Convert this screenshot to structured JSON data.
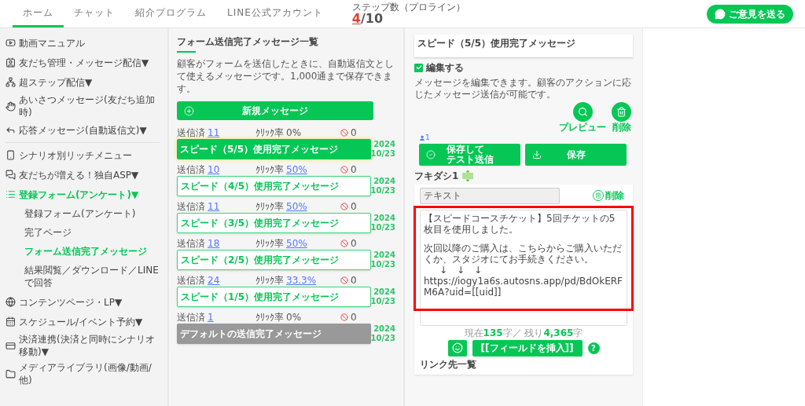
{
  "nav": {
    "tabs": [
      {
        "label": "ホーム",
        "selected": true
      },
      {
        "label": "チャット",
        "selected": false
      },
      {
        "label": "紹介プログラム",
        "selected": false
      },
      {
        "label": "LINE公式アカウント",
        "selected": false
      }
    ],
    "step_label": "ステップ数（プロライン）",
    "step_used": "4",
    "step_total": "/10",
    "feedback_button": "ご意見を送る"
  },
  "sidebar": {
    "groups": [
      [
        {
          "label": "動画マニュアル",
          "selected": false
        },
        {
          "label": "友だち管理・メッセージ配信",
          "arrow": "▼",
          "selected": false
        },
        {
          "label": "超ステップ配信",
          "arrow": "▼",
          "selected": false
        },
        {
          "label": "あいさつメッセージ",
          "note": "(友だち追加時)",
          "selected": false
        },
        {
          "label": "応答メッセージ",
          "note": "(自動返信文)",
          "arrow": "▼",
          "selected": false
        }
      ],
      [
        {
          "label": "シナリオ別リッチメニュー",
          "selected": false
        },
        {
          "label": "友だちが増える！独自ASP",
          "arrow": "▼",
          "selected": false
        },
        {
          "label": "登録フォーム",
          "note": "(アンケート)",
          "arrow": "▼",
          "selected": true,
          "children": [
            {
              "label": "登録フォーム",
              "note": "(アンケート)",
              "selected": false
            },
            {
              "label": "完了ページ",
              "selected": false
            },
            {
              "label": "フォーム送信完了メッセージ",
              "selected": true
            },
            {
              "label": "結果閲覧／ダウンロード／LINEで回答",
              "selected": false
            }
          ]
        },
        {
          "label": "コンテンツページ・LP",
          "arrow": "▼",
          "selected": false
        },
        {
          "label": "スケジュール/イベント予約",
          "arrow": "▼",
          "selected": false
        },
        {
          "label": "決済連携",
          "note": "(決済と同時にシナリオ移動)",
          "arrow": "▼",
          "selected": false
        },
        {
          "label": "メディアライブラリ",
          "note": "(画像/動画/他)",
          "selected": false
        }
      ]
    ]
  },
  "list": {
    "title": "フォーム送信完了メッセージ一覧",
    "description": "顧客がフォームを送信したときに、自動返信文として使えるメッセージです。1,000通まで保存できます。",
    "new_button": "新規メッセージ",
    "messages": [
      {
        "sent_label": "送信済",
        "sent": "11",
        "click_label": "ｸﾘｯｸ率",
        "click": "0%",
        "click_link": false,
        "blocked": "0",
        "title": "スピード（5/5）使用完了メッセージ",
        "kind": "normal",
        "selected": true,
        "year": "2024",
        "date": "10/23"
      },
      {
        "sent_label": "送信済",
        "sent": "10",
        "click_label": "ｸﾘｯｸ率",
        "click": "50%",
        "click_link": true,
        "blocked": "0",
        "title": "スピード（4/5）使用完了メッセージ",
        "kind": "normal",
        "selected": false,
        "year": "2024",
        "date": "10/23"
      },
      {
        "sent_label": "送信済",
        "sent": "11",
        "click_label": "ｸﾘｯｸ率",
        "click": "50%",
        "click_link": true,
        "blocked": "0",
        "title": "スピード（3/5）使用完了メッセージ",
        "kind": "normal",
        "selected": false,
        "year": "2024",
        "date": "10/23"
      },
      {
        "sent_label": "送信済",
        "sent": "18",
        "click_label": "ｸﾘｯｸ率",
        "click": "50%",
        "click_link": true,
        "blocked": "0",
        "title": "スピード（2/5）使用完了メッセージ",
        "kind": "normal",
        "selected": false,
        "year": "2024",
        "date": "10/23"
      },
      {
        "sent_label": "送信済",
        "sent": "24",
        "click_label": "ｸﾘｯｸ率",
        "click": "33.3%",
        "click_link": true,
        "blocked": "0",
        "title": "スピード（1/5）使用完了メッセージ",
        "kind": "normal",
        "selected": false,
        "year": "2024",
        "date": "10/23"
      },
      {
        "sent_label": "送信済",
        "sent": "1",
        "click_label": "ｸﾘｯｸ率",
        "click": "0%",
        "click_link": false,
        "blocked": "0",
        "title": "デフォルトの送信完了メッセージ",
        "kind": "default",
        "selected": false,
        "year": "2024",
        "date": "10/23"
      }
    ]
  },
  "editor": {
    "name": "スピード（5/5）使用完了メッセージ",
    "edit_label": "編集する",
    "edit_checked": true,
    "description": "メッセージを編集できます。顧客のアクションに応じたメッセージ送信が可能です。",
    "preview_label": "プレビュー",
    "delete_label": "削除",
    "user_count": "1",
    "save_test_lines": [
      "保存して",
      "テスト送信"
    ],
    "save_button": "保存",
    "bubble_title": "フキダシ1",
    "type_value": "テキスト",
    "bubble_delete": "削除",
    "message_lines": [
      "【スピードコースチケット】5回チケットの5枚目を使用しました。",
      "次回以降のご購入は、こちらからご購入いただくか、スタジオにてお手続きください。",
      "↓　↓　↓",
      "https://iogy1a6s.autosns.app/pd/BdOkERFM6A?uid=[[uid]]"
    ],
    "count_prefix": "現在",
    "count_value": "135",
    "count_mid": "字／ 残り",
    "count_remaining": "4,365",
    "count_suffix": "字",
    "insert_button": "[[フィールドを挿入]]",
    "help": "?",
    "links_title": "リンク先一覧"
  }
}
